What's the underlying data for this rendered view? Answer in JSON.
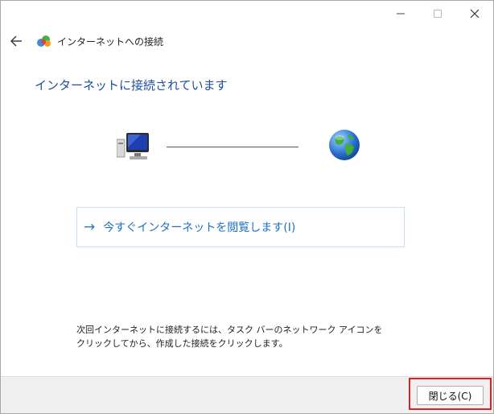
{
  "window": {
    "title": "インターネットへの接続",
    "controls": {
      "minimize_icon": "minimize-icon",
      "maximize_icon": "maximize-icon",
      "close_icon": "close-icon"
    }
  },
  "nav": {
    "back_icon": "back-arrow-icon",
    "app_icon": "network-globe-icon"
  },
  "main": {
    "heading": "インターネットに接続されています",
    "diagram": {
      "computer_icon": "computer-icon",
      "globe_icon": "globe-icon"
    },
    "browse_link": {
      "arrow": "→",
      "label": "今すぐインターネットを閲覧します(I)"
    },
    "info_line1": "次回インターネットに接続するには、タスク バーのネットワーク アイコンを",
    "info_line2": "クリックしてから、作成した接続をクリックします。"
  },
  "footer": {
    "close_label": "閉じる(C)"
  },
  "colors": {
    "heading": "#1d4f9d",
    "link": "#1f6fc4",
    "highlight": "#e02020",
    "footer_bg": "#f0f0f0"
  }
}
